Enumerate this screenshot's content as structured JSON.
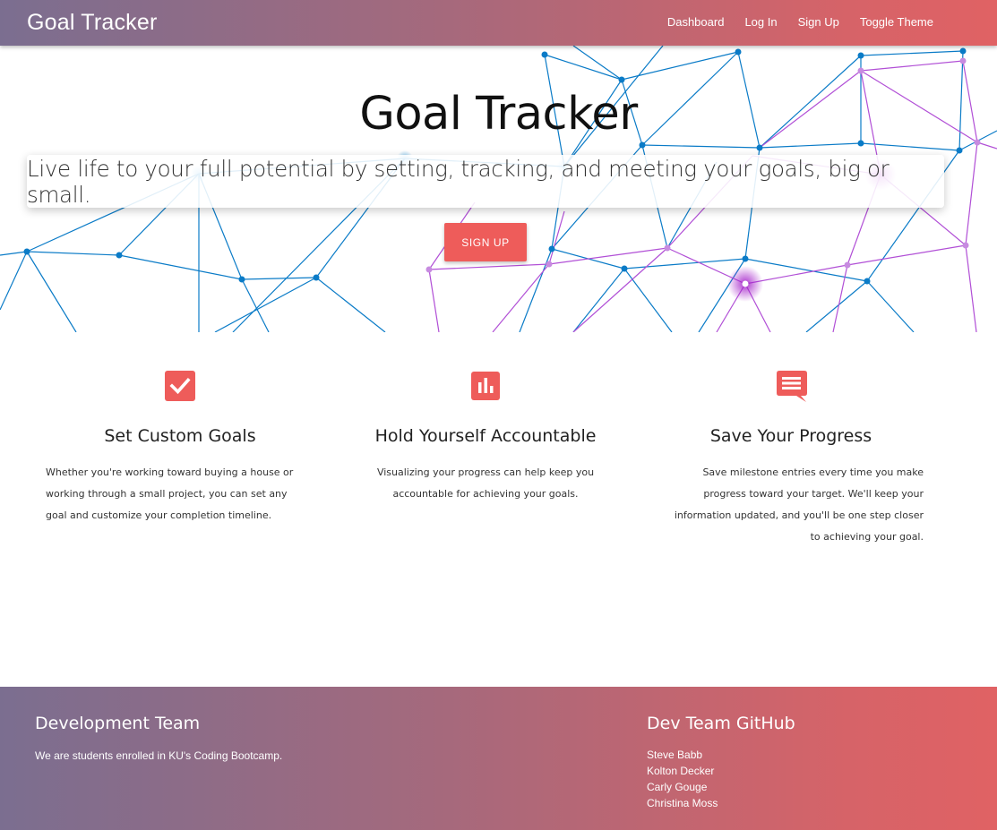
{
  "navbar": {
    "brand": "Goal Tracker",
    "links": [
      "Dashboard",
      "Log In",
      "Sign Up",
      "Toggle Theme"
    ]
  },
  "hero": {
    "title": "Goal Tracker",
    "tagline": "Live life to your full potential by setting, tracking, and meeting your goals, big or small.",
    "signup_label": "SIGN UP"
  },
  "features": [
    {
      "icon": "checkbox-checked-icon",
      "title": "Set Custom Goals",
      "text": "Whether you're working toward buying a house or working through a small project, you can set any goal and customize your completion timeline."
    },
    {
      "icon": "bar-chart-icon",
      "title": "Hold Yourself Accountable",
      "text": "Visualizing your progress can help keep you accountable for achieving your goals."
    },
    {
      "icon": "message-lines-icon",
      "title": "Save Your Progress",
      "text": "Save milestone entries every time you make progress toward your target. We'll keep your information updated, and you'll be one step closer to achieving your goal."
    }
  ],
  "footer": {
    "team_title": "Development Team",
    "team_text": "We are students enrolled in KU's Coding Bootcamp.",
    "github_title": "Dev Team GitHub",
    "members": [
      "Steve Babb",
      "Kolton Decker",
      "Carly Gouge",
      "Christina Moss"
    ]
  },
  "colors": {
    "accent": "#ee5c5a",
    "gradient_start": "#7b6e90",
    "gradient_end": "#e06264",
    "network_blue": "#0a7bc7",
    "network_purple": "#b14fd6"
  }
}
